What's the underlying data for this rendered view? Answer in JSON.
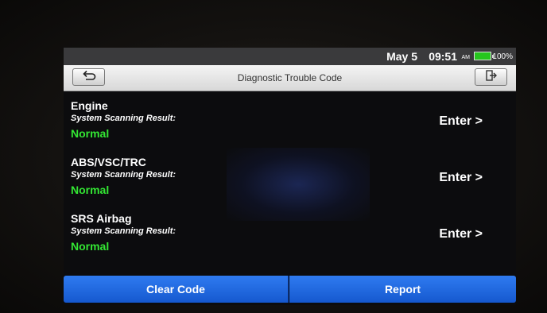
{
  "status_bar": {
    "date": "May 5",
    "time": "09:51",
    "ampm": "AM",
    "battery": "100%",
    "battery_color": "#26c61e"
  },
  "header": {
    "title": "Diagnostic Trouble Code",
    "back_icon": "back-arrow-icon",
    "exit_icon": "exit-icon"
  },
  "systems": [
    {
      "name": "Engine",
      "caption": "System Scanning Result:",
      "status": "Normal",
      "action": "Enter >"
    },
    {
      "name": "ABS/VSC/TRC",
      "caption": "System Scanning Result:",
      "status": "Normal",
      "action": "Enter >"
    },
    {
      "name": "SRS Airbag",
      "caption": "System Scanning Result:",
      "status": "Normal",
      "action": "Enter >"
    }
  ],
  "footer": {
    "clear_code": "Clear Code",
    "report": "Report",
    "button_color": "#1e6be6"
  },
  "colors": {
    "status_normal": "#33e633",
    "background": "#0c0c0e"
  }
}
